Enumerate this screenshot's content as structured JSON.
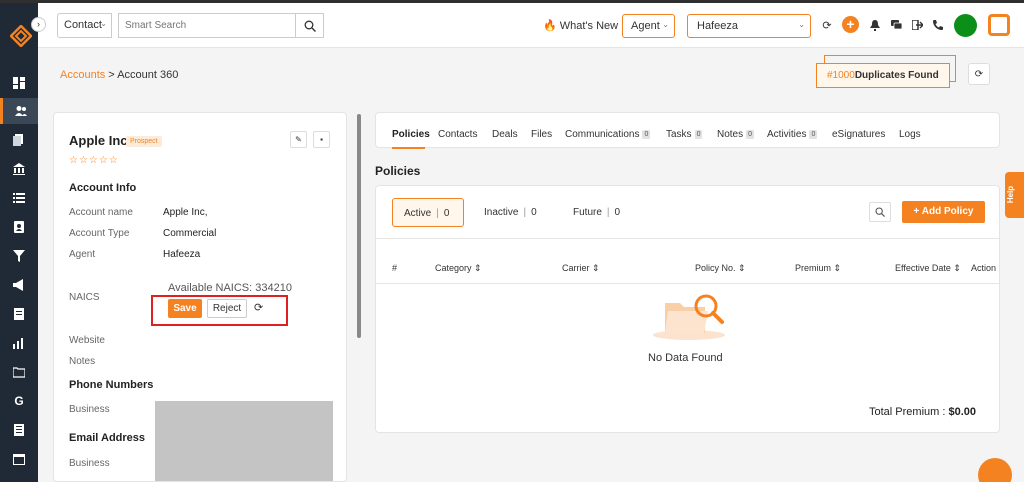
{
  "header": {
    "contact_select": "Contact",
    "search_placeholder": "Smart Search",
    "whats_new": "What's New",
    "agent_select": "Agent",
    "user_select": "Hafeeza"
  },
  "breadcrumb": {
    "link": "Accounts",
    "separator": " > ",
    "current": "Account 360"
  },
  "duplicates": {
    "count": "#1000",
    "label": "Duplicates Found"
  },
  "account": {
    "name": "Apple Inc,",
    "badge": "Prospect",
    "stars": "☆☆☆☆☆",
    "info_heading": "Account Info",
    "fields": [
      {
        "label": "Account name",
        "value": "Apple Inc,"
      },
      {
        "label": "Account Type",
        "value": "Commercial"
      },
      {
        "label": "Agent",
        "value": "Hafeeza"
      }
    ],
    "naics_label": "NAICS",
    "naics_hint": "Available NAICS: 334210",
    "save_label": "Save",
    "reject_label": "Reject",
    "website_label": "Website",
    "notes_label": "Notes",
    "phone_heading": "Phone Numbers",
    "phone_business_label": "Business",
    "email_heading": "Email Address",
    "email_business_label": "Business"
  },
  "tabs": [
    {
      "label": "Policies"
    },
    {
      "label": "Contacts"
    },
    {
      "label": "Deals"
    },
    {
      "label": "Files"
    },
    {
      "label": "Communications",
      "count": "0"
    },
    {
      "label": "Tasks",
      "count": "0"
    },
    {
      "label": "Notes",
      "count": "0"
    },
    {
      "label": "Activities",
      "count": "0"
    },
    {
      "label": "eSignatures"
    },
    {
      "label": "Logs"
    }
  ],
  "policies": {
    "title": "Policies",
    "filters": [
      {
        "label": "Active",
        "count": "0"
      },
      {
        "label": "Inactive",
        "count": "0"
      },
      {
        "label": "Future",
        "count": "0"
      }
    ],
    "add_button": "+ Add Policy",
    "columns": [
      "#",
      "Category ⇕",
      "Carrier ⇕",
      "Policy No. ⇕",
      "Premium ⇕",
      "Effective Date ⇕",
      "Action"
    ],
    "empty_text": "No Data Found",
    "total_label": "Total Premium : ",
    "total_value": "$0.00"
  },
  "help_label": "Help",
  "colors": {
    "accent": "#f58220",
    "sidebar": "#1f2a36",
    "highlight_box": "#e02020"
  }
}
